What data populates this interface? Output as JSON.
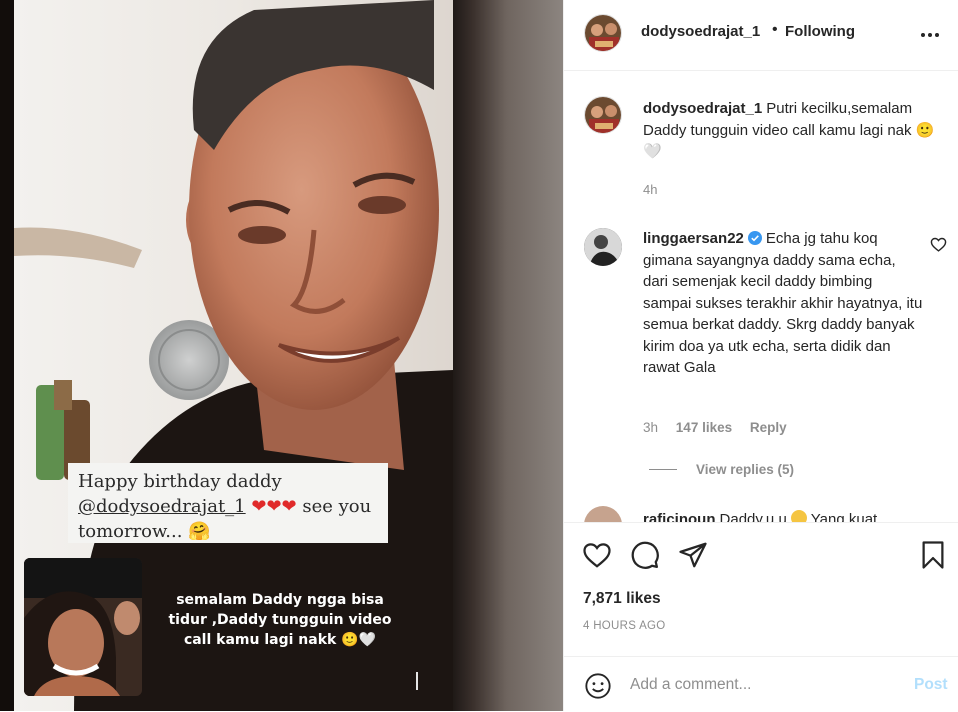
{
  "colors": {
    "text": "#262626",
    "secondary": "#8e8e8e",
    "border": "#efefef",
    "link_disabled": "#b2dffc",
    "verified": "#3897f0",
    "heart": "#e02a2a"
  },
  "media": {
    "story_text": {
      "line1": "Happy birthday daddy",
      "mention": "@dodysoedrajat_1",
      "hearts": "❤❤❤",
      "line2_rest": " see you",
      "line3": "tomorrow... 🤗"
    },
    "overlay_caption": {
      "line1": "semalam Daddy ngga bisa",
      "line2": "tidur ,Daddy tungguin video",
      "line3": "call kamu lagi nakk 🙂🤍"
    }
  },
  "header": {
    "username": "dodysoedrajat_1",
    "separator": "•",
    "follow_label": "Following",
    "more_icon": "more-horizontal-icon"
  },
  "caption": {
    "username": "dodysoedrajat_1",
    "text": "Putri kecilku,semalam Daddy tungguin video call kamu lagi nak 🙂🤍",
    "time": "4h"
  },
  "comment": {
    "username": "linggaersan22",
    "verified": true,
    "text": "Echa jg tahu koq gimana sayangnya daddy sama echa, dari semenjak kecil daddy bimbing sampai sukses terakhir akhir hayatnya, itu semua berkat daddy. Skrg daddy banyak kirim doa ya utk echa, serta didik dan rawat Gala",
    "time": "3h",
    "likes": "147 likes",
    "reply_label": "Reply",
    "view_replies": "View replies (5)"
  },
  "partial_comment": {
    "username": "raficinoun",
    "text_start": "Daddy.u.u",
    "text_end": "Yang kuat"
  },
  "actions": {
    "icons": [
      "heart-icon",
      "comment-icon",
      "share-icon",
      "bookmark-icon"
    ],
    "likes": "7,871 likes",
    "posted": "4 HOURS AGO"
  },
  "add_comment": {
    "placeholder": "Add a comment...",
    "post_label": "Post"
  }
}
